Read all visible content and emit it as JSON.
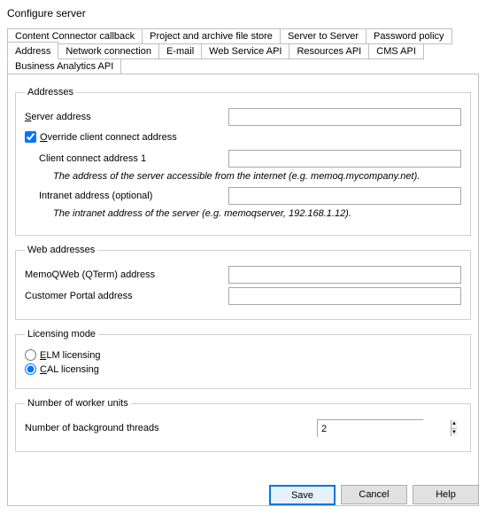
{
  "title": "Configure server",
  "tabs_row1": [
    "Content Connector callback",
    "Project and archive file store",
    "Server to Server",
    "Password policy"
  ],
  "tabs_row2": [
    "Address",
    "Network connection",
    "E-mail",
    "Web Service API",
    "Resources API",
    "CMS API",
    "Business Analytics API"
  ],
  "addresses": {
    "legend": "Addresses",
    "server_address_label": "Server address",
    "server_address_value": "",
    "override_label": "Override client connect address",
    "override_checked": true,
    "client_connect_label": "Client connect address 1",
    "client_connect_value": "",
    "client_note": "The address of the server accessible from the internet (e.g. memoq.mycompany.net).",
    "intranet_label": "Intranet address (optional)",
    "intranet_value": "",
    "intranet_note": "The intranet address of the server (e.g. memoqserver, 192.168.1.12)."
  },
  "web": {
    "legend": "Web addresses",
    "qterm_label": "MemoQWeb (QTerm) address",
    "qterm_value": "",
    "portal_label": "Customer Portal address",
    "portal_value": ""
  },
  "licensing": {
    "legend": "Licensing mode",
    "elm_label": "ELM licensing",
    "cal_label": "CAL licensing",
    "selected": "cal"
  },
  "worker": {
    "legend": "Number of worker units",
    "threads_label": "Number of background threads",
    "threads_value": "2"
  },
  "buttons": {
    "save": "Save",
    "cancel": "Cancel",
    "help": "Help"
  }
}
